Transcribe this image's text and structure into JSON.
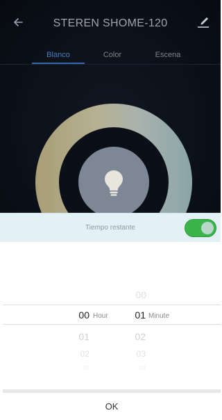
{
  "header": {
    "title": "STEREN SHOME-120",
    "back_icon": "arrow-left-icon",
    "edit_icon": "pencil-icon"
  },
  "tabs": [
    {
      "label": "Blanco",
      "active": true
    },
    {
      "label": "Color",
      "active": false
    },
    {
      "label": "Escena",
      "active": false
    }
  ],
  "light": {
    "bulb_icon": "lightbulb-icon"
  },
  "timer": {
    "label": "Tiempo restante",
    "enabled": true,
    "accent": "#39b54a"
  },
  "picker": {
    "hours": {
      "above": [
        "",
        ""
      ],
      "selected": "00",
      "below": [
        "01",
        "02",
        "03"
      ],
      "unit": "Hour"
    },
    "minutes": {
      "above": [
        "00"
      ],
      "selected": "01",
      "below": [
        "02",
        "03",
        "04"
      ],
      "unit": "Minute"
    },
    "ok_label": "OK"
  }
}
